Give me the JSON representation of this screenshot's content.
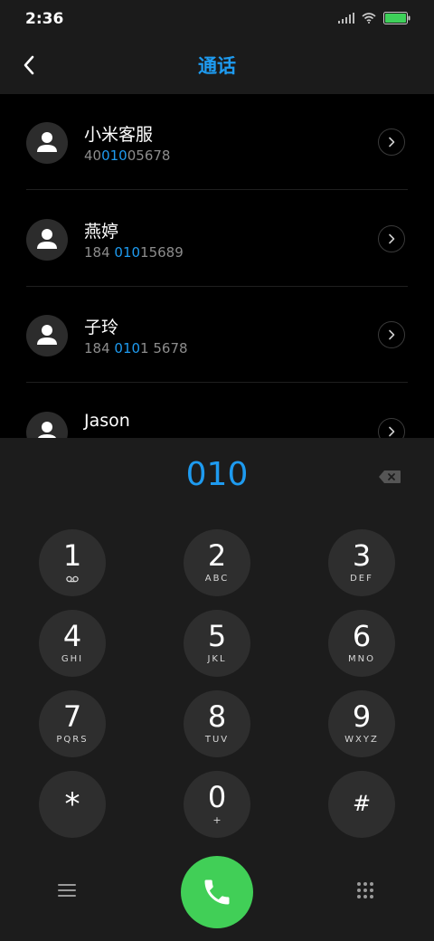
{
  "status": {
    "time": "2:36"
  },
  "header": {
    "title": "通话"
  },
  "contacts": [
    {
      "name": "小米客服",
      "number_pre": "40",
      "number_match": "010",
      "number_post": "05678"
    },
    {
      "name": "燕婷",
      "number_pre": "184 ",
      "number_match": "010",
      "number_post": "15689"
    },
    {
      "name": "子玲",
      "number_pre": "184 ",
      "number_match": "010",
      "number_post": "1 5678"
    },
    {
      "name": "Jason",
      "number_pre": "",
      "number_match": "",
      "number_post": ""
    }
  ],
  "dialer": {
    "input": "010",
    "keys": [
      {
        "digit": "1",
        "letters": ""
      },
      {
        "digit": "2",
        "letters": "ABC"
      },
      {
        "digit": "3",
        "letters": "DEF"
      },
      {
        "digit": "4",
        "letters": "GHI"
      },
      {
        "digit": "5",
        "letters": "JKL"
      },
      {
        "digit": "6",
        "letters": "MNO"
      },
      {
        "digit": "7",
        "letters": "PQRS"
      },
      {
        "digit": "8",
        "letters": "TUV"
      },
      {
        "digit": "9",
        "letters": "WXYZ"
      },
      {
        "digit": "*",
        "letters": ""
      },
      {
        "digit": "0",
        "letters": "+"
      },
      {
        "digit": "#",
        "letters": ""
      }
    ]
  },
  "colors": {
    "accent": "#1e9bf0",
    "call": "#41cf57",
    "battery": "#3ed15a"
  },
  "icons": {
    "signal": "signal-icon",
    "wifi": "wifi-icon",
    "battery": "battery-icon",
    "back": "back-chevron-icon",
    "avatar": "person-icon",
    "detail": "chevron-right-icon",
    "backspace": "backspace-icon",
    "voicemail": "voicemail-icon",
    "menu": "menu-icon",
    "call": "phone-icon",
    "keypad": "keypad-icon"
  }
}
